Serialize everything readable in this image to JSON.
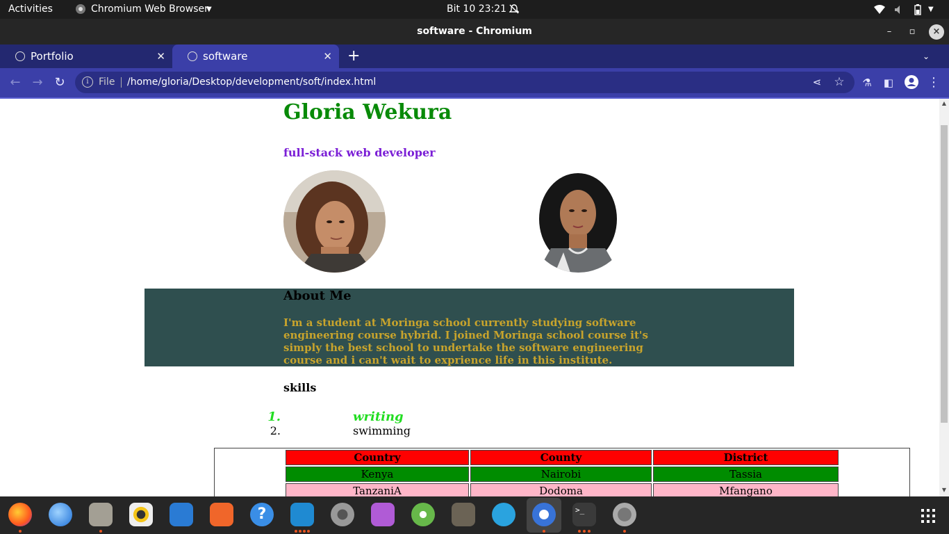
{
  "topbar": {
    "activities": "Activities",
    "app_name": "Chromium Web Browser",
    "clock": "Bit 10  23:21"
  },
  "window": {
    "title": "software - Chromium"
  },
  "tabs": [
    {
      "label": "Portfolio"
    },
    {
      "label": "software"
    }
  ],
  "omnibox": {
    "scheme_label": "File",
    "url": "/home/gloria/Desktop/development/soft/index.html"
  },
  "page": {
    "name": "Gloria Wekura",
    "role": "full-stack web developer",
    "about_heading": "About Me",
    "about_text": "I'm a student at Moringa school currently studying software engineering course hybrid. I joined Moringa school course it's simply the best school to undertake the software engineering course and i can't wait to exprience life in this institute.",
    "skills_heading": "skills",
    "skills": [
      {
        "num": "1.",
        "text": "writing"
      },
      {
        "num": "2.",
        "text": "swimming"
      }
    ],
    "table": {
      "headers": [
        "Country",
        "County",
        "District"
      ],
      "rows": [
        [
          "Kenya",
          "Nairobi",
          "Tassia"
        ],
        [
          "TanzaniA",
          "Dodoma",
          "Mfangano"
        ]
      ]
    }
  },
  "colors": {
    "name": "#088a08",
    "role": "#7b1fd6",
    "about_bg": "#2f4f4f",
    "about_text": "#c8a42c",
    "skill_highlight": "#22dd22",
    "table_header_bg": "#ff0000",
    "table_row1_bg": "#008c00",
    "table_row2_bg": "#ffb6c8"
  },
  "dock_apps": [
    "firefox-icon",
    "thunderbird-icon",
    "files-icon",
    "rhythmbox-icon",
    "libreoffice-writer-icon",
    "software-center-icon",
    "help-icon",
    "vscode-icon",
    "settings-icon",
    "video-player-icon",
    "keyring-icon",
    "gimp-icon",
    "telegram-icon",
    "chromium-icon",
    "terminal-icon",
    "software-updater-icon",
    "app-grid-icon"
  ]
}
